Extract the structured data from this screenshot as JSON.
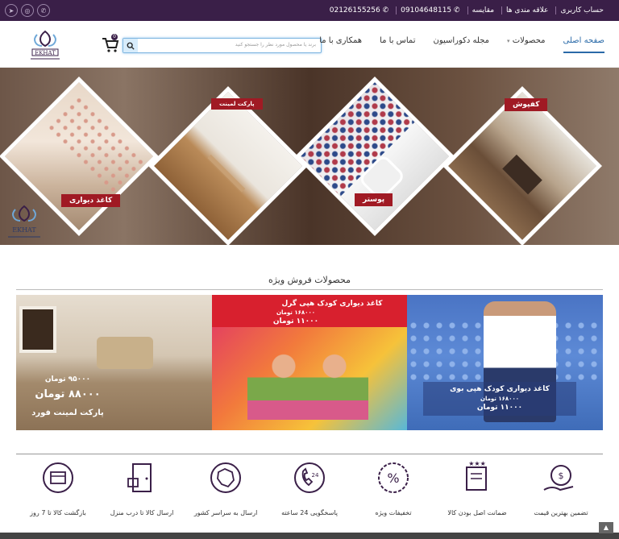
{
  "topbar": {
    "account": "حساب کاربری",
    "wishlist": "علاقه مندی ها",
    "compare": "مقایسه",
    "phone1": "09104648115",
    "phone2": "02126155256"
  },
  "header": {
    "search_placeholder": "برند یا محصول مورد نظر را جستجو کنید",
    "cart_count": "0",
    "nav": [
      "صفحه اصلی",
      "محصولات",
      "مجله دکوراسیون",
      "تماس با ما",
      "همکاری با ما"
    ]
  },
  "hero": {
    "tags": [
      "کفپوش",
      "پوستر",
      "پارکت لمینت",
      "کاغذ دیواری"
    ]
  },
  "special": {
    "title": "محصولات فروش ویژه",
    "banners": [
      {
        "name": "کاغذ دیواری کودک هپی بوی",
        "old_price": "۱۶۸۰۰۰ تومان",
        "new_price": "۱۱۰۰۰ تومان"
      },
      {
        "name": "کاغذ دیواری کودک هپی گرل",
        "old_price": "۱۶۸۰۰۰ تومان",
        "new_price": "۱۱۰۰۰ تومان"
      },
      {
        "name": "پارکت لمینت فورد",
        "old_price": "۹۵۰۰۰ تومان",
        "new_price": "۸۸۰۰۰ تومان"
      }
    ]
  },
  "features": [
    "تضمین بهترین قیمت",
    "ضمانت اصل بودن کالا",
    "تخفیفات ویژه",
    "پاسخگویی 24 ساعته",
    "ارسال به سراسر کشور",
    "ارسال کالا تا درب منزل",
    "بازگشت کالا تا 7 روز"
  ],
  "colors": {
    "brand": "#3a1f48",
    "accent": "#a01a24",
    "link": "#2a6aa8"
  }
}
